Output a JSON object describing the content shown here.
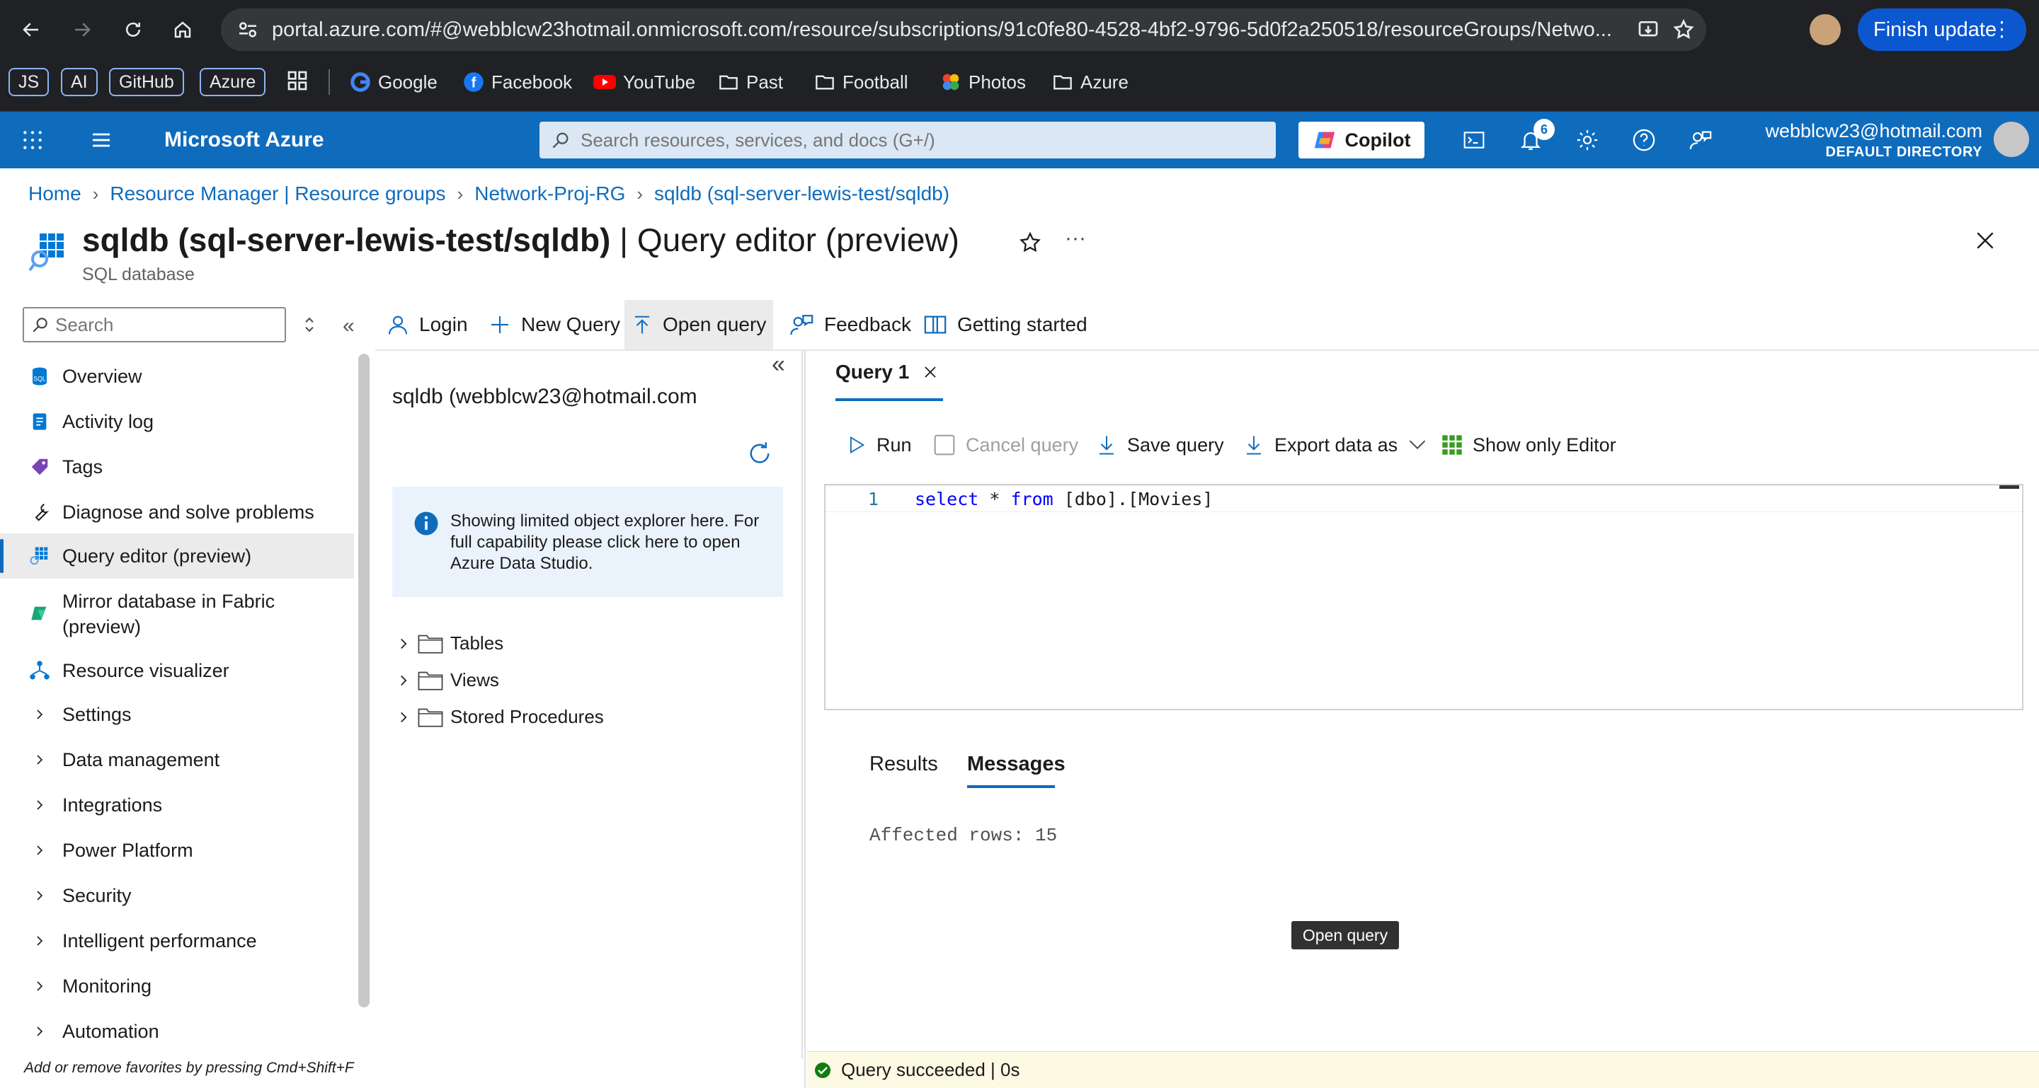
{
  "browser": {
    "url": "portal.azure.com/#@webblcw23hotmail.onmicrosoft.com/resource/subscriptions/91c0fe80-4528-4bf2-9796-5d0f2a250518/resourceGroups/Netwo...",
    "finish_update": "Finish update",
    "bookmarks": {
      "chips": [
        "JS",
        "AI",
        "GitHub",
        "Azure"
      ],
      "items": [
        "Google",
        "Facebook",
        "YouTube",
        "Past",
        "Football",
        "Photos",
        "Azure"
      ]
    }
  },
  "header": {
    "brand": "Microsoft Azure",
    "search_placeholder": "Search resources, services, and docs (G+/)",
    "copilot": "Copilot",
    "notifications_count": "6",
    "account_email": "webblcw23@hotmail.com",
    "account_directory": "DEFAULT DIRECTORY"
  },
  "breadcrumb": [
    "Home",
    "Resource Manager | Resource groups",
    "Network-Proj-RG",
    "sqldb (sql-server-lewis-test/sqldb)"
  ],
  "page": {
    "title_bold": "sqldb (sql-server-lewis-test/sqldb)",
    "title_rest": " | Query editor (preview)",
    "subtitle": "SQL database"
  },
  "nav": {
    "search_placeholder": "Search",
    "items": [
      "Overview",
      "Activity log",
      "Tags",
      "Diagnose and solve problems",
      "Query editor (preview)",
      "Mirror database in Fabric",
      "(preview)",
      "Resource visualizer",
      "Settings",
      "Data management",
      "Integrations",
      "Power Platform",
      "Security",
      "Intelligent performance",
      "Monitoring",
      "Automation"
    ],
    "footer": "Add or remove favorites by pressing Cmd+Shift+F"
  },
  "toolbar": {
    "login": "Login",
    "new_query": "New Query",
    "open_query": "Open query",
    "feedback": "Feedback",
    "getting_started": "Getting started"
  },
  "explorer": {
    "title": "sqldb (webblcw23@hotmail.com",
    "info": "Showing limited object explorer here. For full capability please click here to open Azure Data Studio.",
    "tree": [
      "Tables",
      "Views",
      "Stored Procedures"
    ]
  },
  "editor": {
    "tab": "Query 1",
    "run": "Run",
    "cancel": "Cancel query",
    "save": "Save query",
    "export": "Export data as",
    "show_only": "Show only Editor",
    "line_number": "1",
    "code_kw1": "select",
    "code_mid": " * ",
    "code_kw2": "from",
    "code_rest": " [dbo].[Movies]"
  },
  "results": {
    "tab_results": "Results",
    "tab_messages": "Messages",
    "message": "Affected rows: 15"
  },
  "tooltip": "Open query",
  "status": "Query succeeded | 0s",
  "colors": {
    "azure_blue": "#0f6cbd",
    "browser_dark": "#202124",
    "success_green": "#107c10"
  }
}
